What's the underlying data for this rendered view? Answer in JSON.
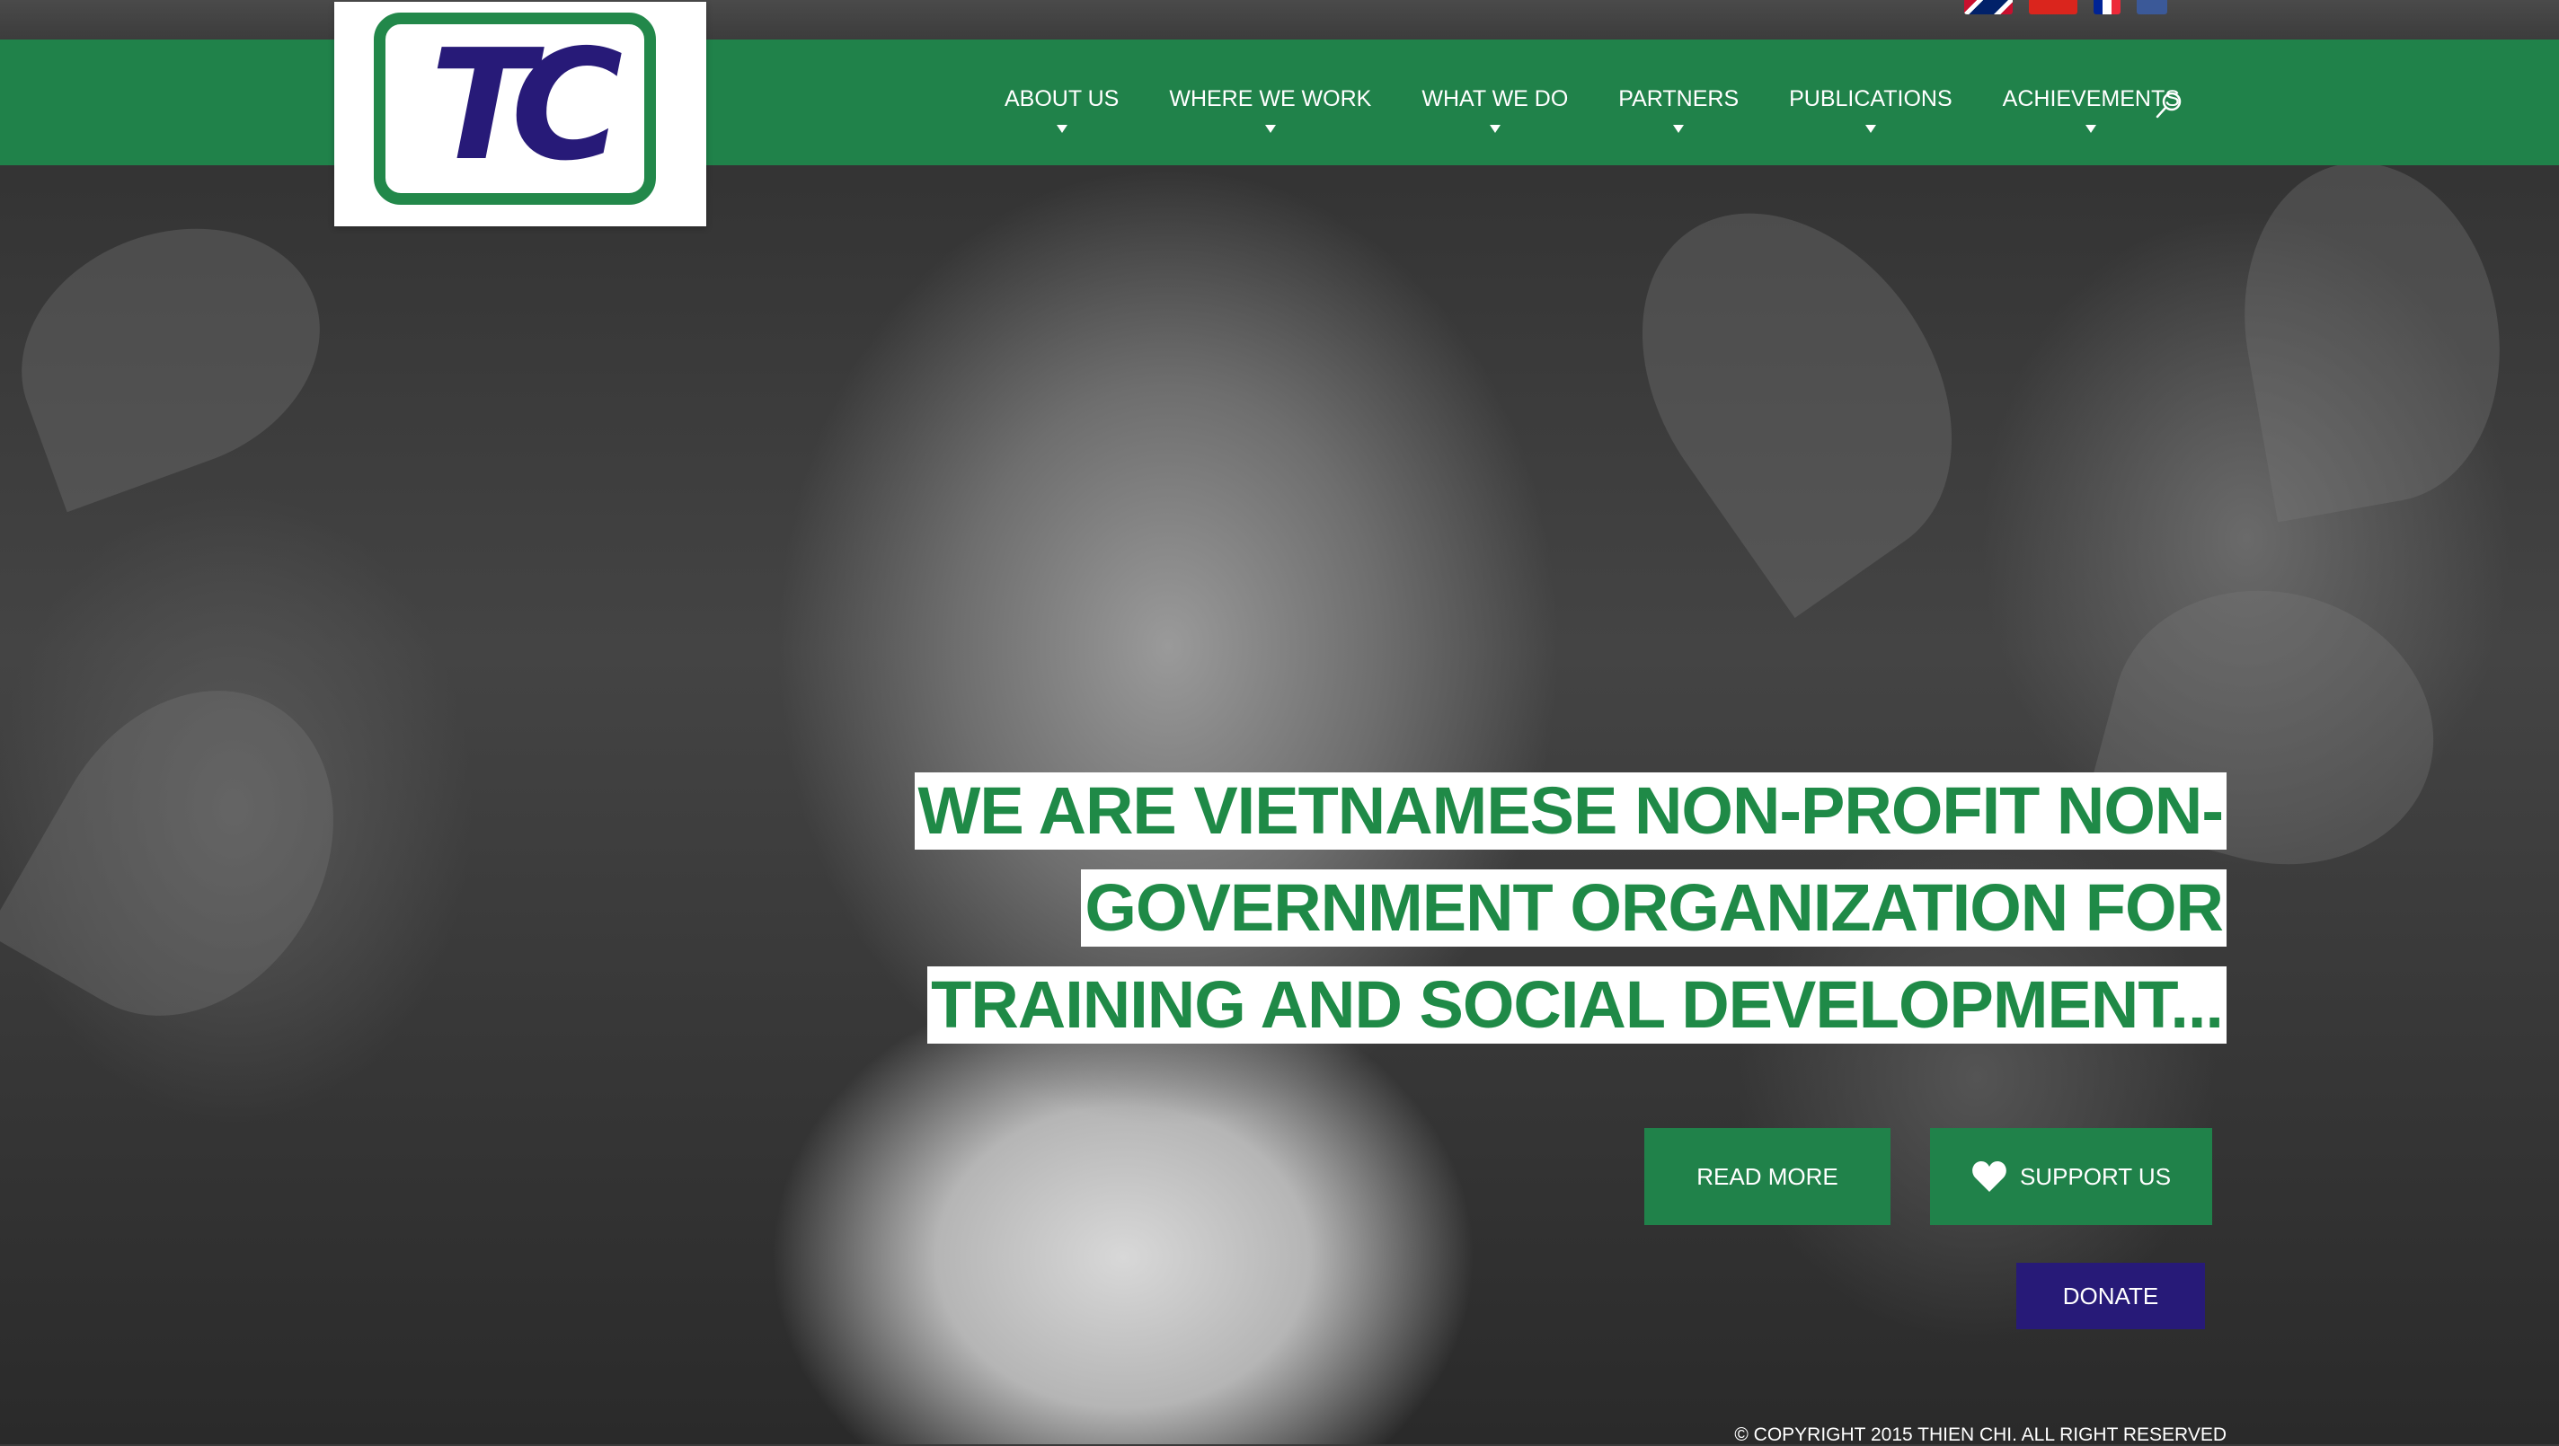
{
  "brand": {
    "logo_text": "TC",
    "primary_color": "#20824a",
    "accent_color": "#271a78"
  },
  "languages": [
    {
      "icon": "uk-flag-icon"
    },
    {
      "icon": "vietnam-flag-icon"
    },
    {
      "icon": "france-flag-icon"
    },
    {
      "icon": "facebook-icon"
    }
  ],
  "nav": {
    "items": [
      {
        "label": "ABOUT US"
      },
      {
        "label": "WHERE WE WORK"
      },
      {
        "label": "WHAT WE DO"
      },
      {
        "label": "PARTNERS"
      },
      {
        "label": "PUBLICATIONS"
      },
      {
        "label": "ACHIEVEMENTS"
      }
    ],
    "search_icon": "search-icon"
  },
  "hero": {
    "tagline_lines": [
      "WE ARE VIETNAMESE NON-PROFIT NON-",
      "GOVERNMENT ORGANIZATION FOR",
      "TRAINING AND SOCIAL DEVELOPMENT..."
    ],
    "read_more_label": "READ MORE",
    "support_label": "SUPPORT US",
    "support_icon": "heart-icon",
    "donate_label": "DONATE"
  },
  "footer": {
    "copyright": "© COPYRIGHT 2015 THIEN CHI. ALL RIGHT RESERVED"
  }
}
